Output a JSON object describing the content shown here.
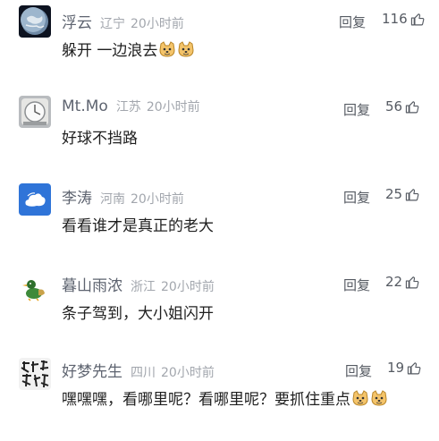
{
  "comments": [
    {
      "username": "浮云",
      "region": "辽宁",
      "time": "20小时前",
      "reply_label": "回复",
      "likes": "116",
      "text": "躲开 一边浪去",
      "avatar": "earth-avatar",
      "emoji_count": 2
    },
    {
      "username": "Mt.Mo",
      "region": "江苏",
      "time": "20小时前",
      "reply_label": "回复",
      "likes": "56",
      "text": "好球不挡路",
      "avatar": "clock-avatar",
      "emoji_count": 0
    },
    {
      "username": "李涛",
      "region": "河南",
      "time": "20小时前",
      "reply_label": "回复",
      "likes": "25",
      "text": "看看谁才是真正的老大",
      "avatar": "cloud-avatar",
      "emoji_count": 0
    },
    {
      "username": "暮山雨浓",
      "region": "浙江",
      "time": "20小时前",
      "reply_label": "回复",
      "likes": "22",
      "text": "条子驾到，大小姐闪开",
      "avatar": "duck-avatar",
      "emoji_count": 0
    },
    {
      "username": "好梦先生",
      "region": "四川",
      "time": "20小时前",
      "reply_label": "回复",
      "likes": "19",
      "text": "嘿嘿嘿，看哪里呢？看哪里呢？要抓住重点",
      "avatar": "calligraphy-avatar",
      "emoji_count": 2
    }
  ],
  "colors": {
    "username": "#5e6470",
    "meta": "#a2a6ad",
    "text": "#1f1f1f",
    "action": "#555a62"
  }
}
